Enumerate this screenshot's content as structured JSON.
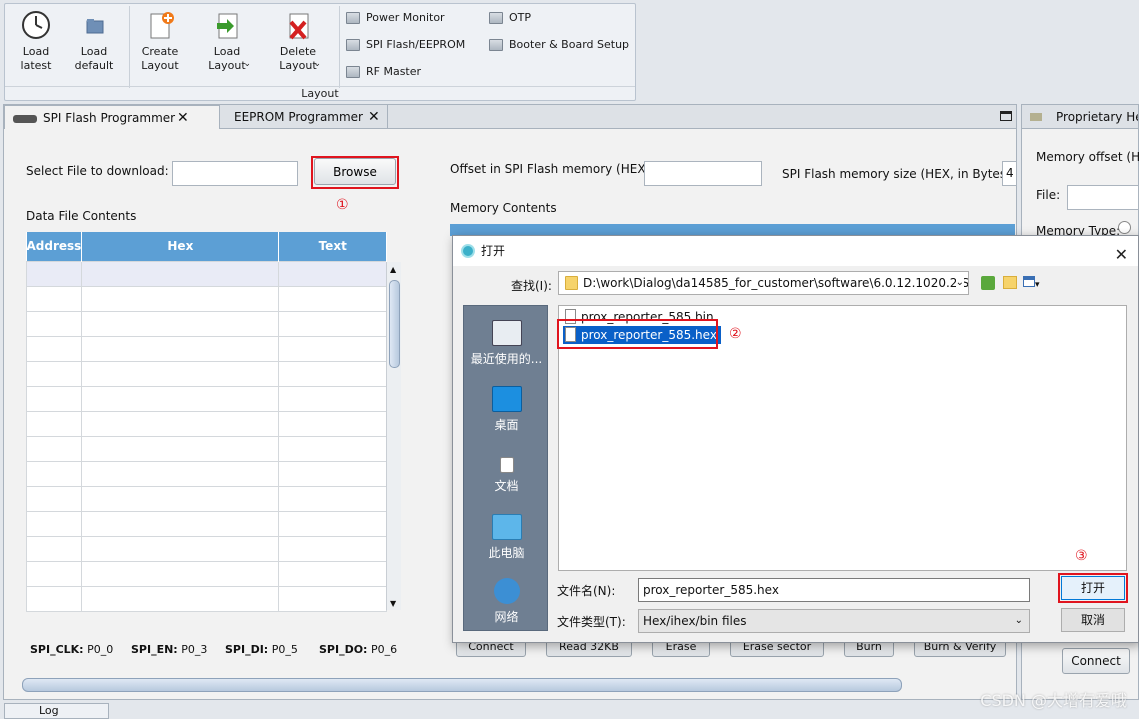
{
  "ribbon": {
    "load_latest": "Load latest",
    "load_default": "Load default",
    "create_layout": "Create Layout",
    "load_layout": "Load Layout",
    "delete_layout": "Delete Layout",
    "power_monitor": "Power Monitor",
    "spi_flash_eeprom": "SPI Flash/EEPROM",
    "rf_master": "RF Master",
    "otp": "OTP",
    "booter_board_setup": "Booter & Board Setup",
    "group_label": "Layout"
  },
  "tabs": [
    {
      "label": "SPI Flash Programmer"
    },
    {
      "label": "EEPROM Programmer"
    }
  ],
  "spi": {
    "select_file_label": "Select File to download:",
    "browse_label": "Browse",
    "data_file_contents": "Data File Contents",
    "offset_label": "Offset in SPI Flash memory (HEX):",
    "memory_size_label": "SPI Flash memory size (HEX, in Bytes):",
    "memory_size_value": "4",
    "memory_contents": "Memory Contents",
    "columns": [
      "Address",
      "Hex",
      "Text"
    ],
    "pins": [
      {
        "name": "SPI_CLK:",
        "value": "P0_0"
      },
      {
        "name": "SPI_EN:",
        "value": "P0_3"
      },
      {
        "name": "SPI_DI:",
        "value": "P0_5"
      },
      {
        "name": "SPI_DO:",
        "value": "P0_6"
      }
    ],
    "buttons": [
      "Connect",
      "Read 32KB",
      "Erase",
      "Erase sector",
      "Burn",
      "Burn & Verify"
    ]
  },
  "annotations": {
    "one": "①",
    "two": "②",
    "three": "③"
  },
  "right_panel": {
    "title": "Proprietary Hea",
    "memory_offset": "Memory offset (HEX",
    "file_label": "File:",
    "memory_type": "Memory Type:",
    "connect_label": "Connect"
  },
  "dialog": {
    "title": "打开",
    "lookin_label": "查找(I):",
    "path": "D:\\work\\Dialog\\da14585_for_customer\\software\\6.0.12.1020.2\\S...",
    "places": [
      "最近使用的...",
      "桌面",
      "文档",
      "此电脑",
      "网络"
    ],
    "files": [
      "prox_reporter_585.bin",
      "prox_reporter_585.hex"
    ],
    "filename_label": "文件名(N):",
    "filename_value": "prox_reporter_585.hex",
    "filetype_label": "文件类型(T):",
    "filetype_value": "Hex/ihex/bin files",
    "open_label": "打开",
    "cancel_label": "取消"
  },
  "log_tab": "Log",
  "watermark": "CSDN @大增有爱哦"
}
